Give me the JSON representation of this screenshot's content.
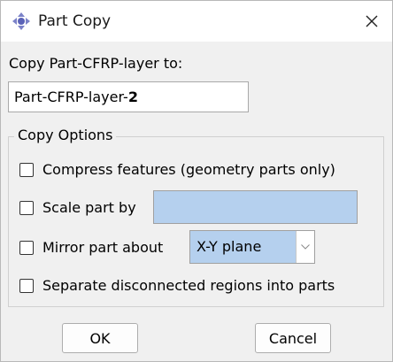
{
  "window": {
    "title": "Part Copy",
    "app_icon": "abaqus-icon",
    "close_icon": "close-icon"
  },
  "copy": {
    "prompt": "Copy Part-CFRP-layer to:",
    "new_name_prefix": "Part-CFRP-layer-",
    "new_name_suffix": "2"
  },
  "options": {
    "group_title": "Copy Options",
    "compress_label": "Compress features (geometry parts only)",
    "scale_label": "Scale part by",
    "scale_value": "",
    "mirror_label": "Mirror part about",
    "mirror_plane": "X-Y plane",
    "separate_label": "Separate disconnected regions into parts"
  },
  "buttons": {
    "ok": "OK",
    "cancel": "Cancel"
  },
  "colors": {
    "field_highlight": "#b5d0ee",
    "dialog_bg": "#f0f0f0"
  }
}
